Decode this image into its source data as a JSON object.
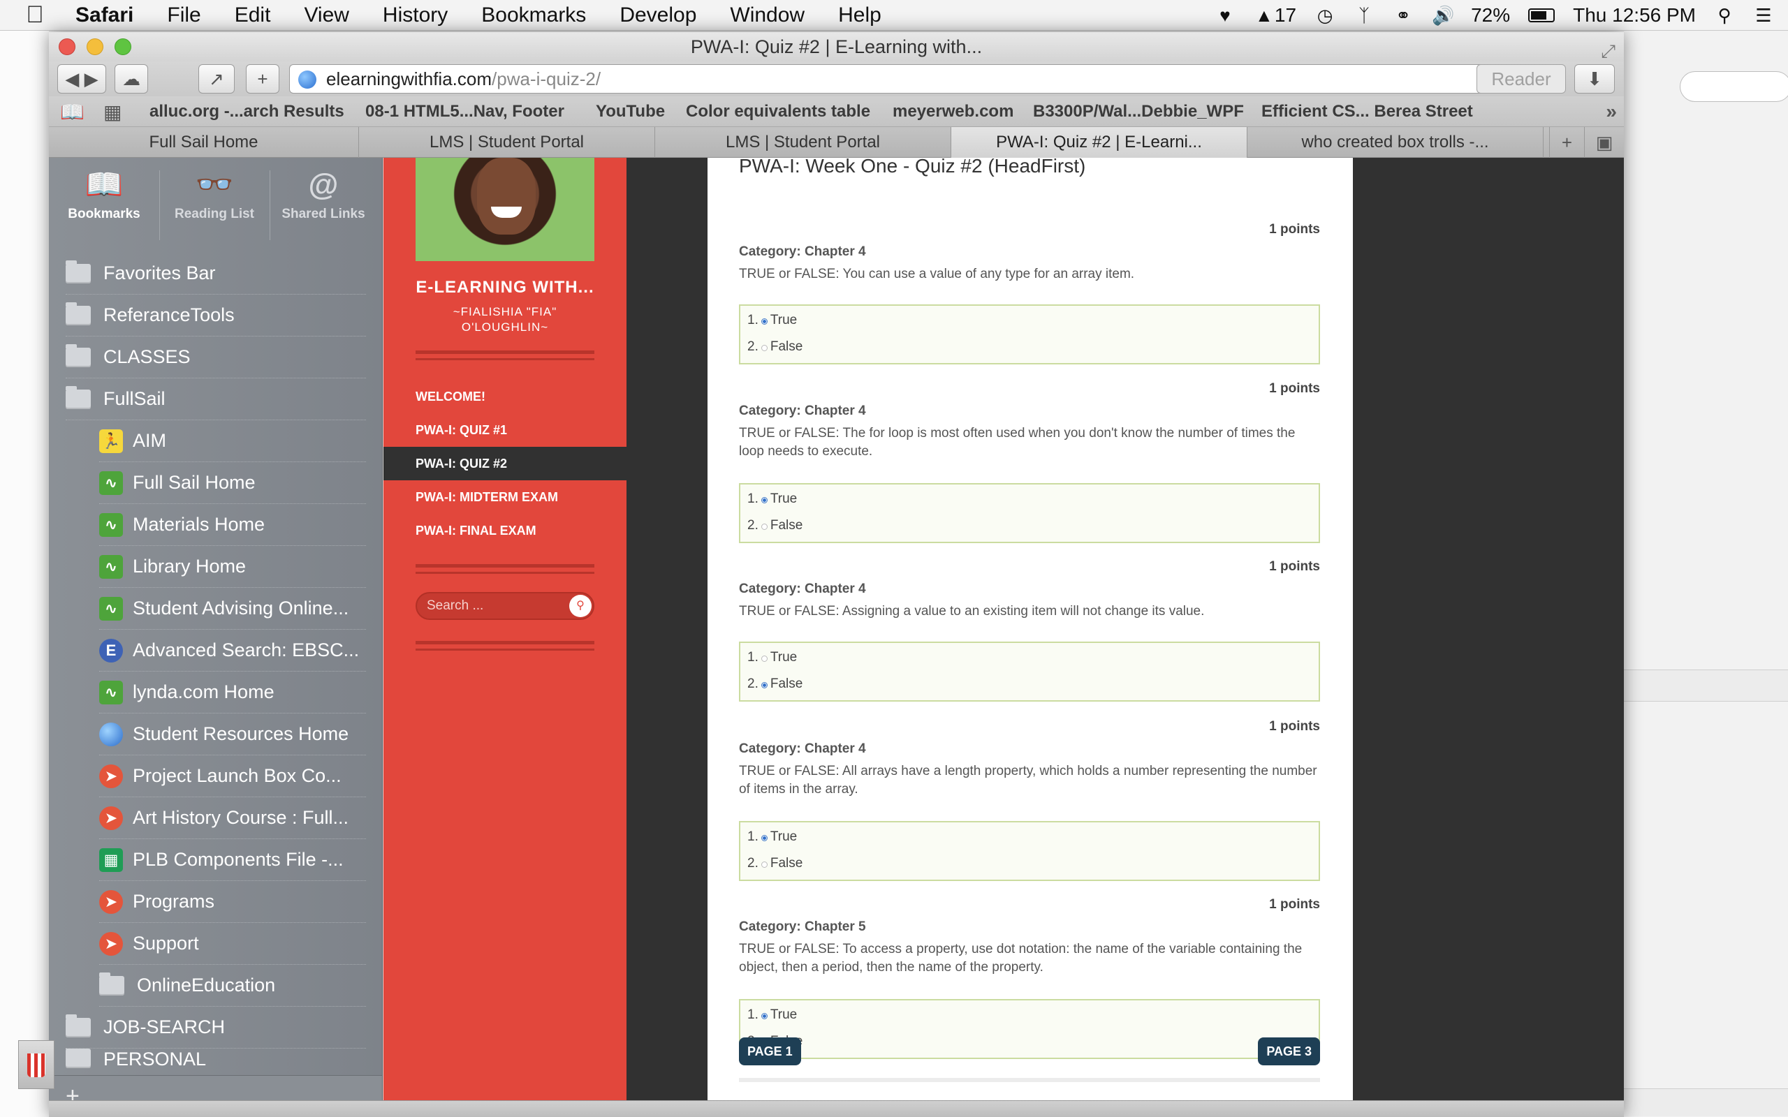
{
  "menubar": {
    "app": "Safari",
    "items": [
      "File",
      "Edit",
      "View",
      "History",
      "Bookmarks",
      "Develop",
      "Window",
      "Help"
    ],
    "status": {
      "notification_count": "17",
      "battery": "72%",
      "battery_level": 0.72,
      "clock": "Thu 12:56 PM"
    }
  },
  "window": {
    "title": "PWA-I: Quiz #2 | E-Learning with...",
    "address": {
      "domain": "elearningwithfia.com",
      "path": "/pwa-i-quiz-2/"
    },
    "reader_label": "Reader",
    "bookmarks_bar": [
      "alluc.org -...arch Results",
      "08-1 HTML5...Nav, Footer",
      "YouTube",
      "Color equivalents table",
      "meyerweb.com",
      "B3300P/Wal...Debbie_WPF",
      "Efficient CS... Berea Street"
    ],
    "tabs": [
      {
        "label": "Full Sail Home",
        "active": false
      },
      {
        "label": "LMS | Student Portal",
        "active": false
      },
      {
        "label": "LMS | Student Portal",
        "active": false
      },
      {
        "label": "PWA-I: Quiz #2 | E-Learni...",
        "active": true
      },
      {
        "label": "who created box trolls -...",
        "active": false
      }
    ]
  },
  "sidebar": {
    "tabs": [
      {
        "label": "Bookmarks",
        "icon": "book-icon"
      },
      {
        "label": "Reading List",
        "icon": "glasses-icon"
      },
      {
        "label": "Shared Links",
        "icon": "at-icon"
      }
    ],
    "items": [
      {
        "label": "Favorites Bar",
        "type": "folder",
        "indent": 0
      },
      {
        "label": "ReferanceTools",
        "type": "folder",
        "indent": 0
      },
      {
        "label": "CLASSES",
        "type": "folder",
        "indent": 0
      },
      {
        "label": "FullSail",
        "type": "folder",
        "indent": 0
      },
      {
        "label": "AIM",
        "type": "site",
        "icon": "aim-icon",
        "indent": 1
      },
      {
        "label": "Full Sail Home",
        "type": "site",
        "icon": "fullsail-icon",
        "indent": 1
      },
      {
        "label": "Materials Home",
        "type": "site",
        "icon": "fullsail-icon",
        "indent": 1
      },
      {
        "label": "Library Home",
        "type": "site",
        "icon": "fullsail-icon",
        "indent": 1
      },
      {
        "label": "Student Advising Online...",
        "type": "site",
        "icon": "fullsail-icon",
        "indent": 1
      },
      {
        "label": "Advanced Search: EBSC...",
        "type": "site",
        "icon": "ebsco-icon",
        "indent": 1
      },
      {
        "label": "lynda.com Home",
        "type": "site",
        "icon": "fullsail-icon",
        "indent": 1
      },
      {
        "label": "Student Resources Home",
        "type": "site",
        "icon": "globe-icon",
        "indent": 1
      },
      {
        "label": "Project Launch Box Co...",
        "type": "site",
        "icon": "launchbox-icon",
        "indent": 1
      },
      {
        "label": "Art History Course : Full...",
        "type": "site",
        "icon": "launchbox-icon",
        "indent": 1
      },
      {
        "label": "PLB Components File -...",
        "type": "site",
        "icon": "spreadsheet-icon",
        "indent": 1
      },
      {
        "label": "Programs",
        "type": "site",
        "icon": "launchbox-icon",
        "indent": 1
      },
      {
        "label": "Support",
        "type": "site",
        "icon": "launchbox-icon",
        "indent": 1
      },
      {
        "label": "OnlineEducation",
        "type": "folder",
        "indent": 1
      },
      {
        "label": "JOB-SEARCH",
        "type": "folder",
        "indent": 0
      },
      {
        "label": "PERSONAL",
        "type": "folder",
        "indent": 0
      }
    ]
  },
  "site": {
    "title": "E-LEARNING WITH...",
    "subtitle": "~FIALISHIA \"FIA\" O'LOUGHLIN~",
    "nav": [
      {
        "label": "WELCOME!",
        "active": false
      },
      {
        "label": "PWA-I: QUIZ #1",
        "active": false
      },
      {
        "label": "PWA-I: QUIZ #2",
        "active": true
      },
      {
        "label": "PWA-I: MIDTERM EXAM",
        "active": false
      },
      {
        "label": "PWA-I: FINAL EXAM",
        "active": false
      }
    ],
    "search_placeholder": "Search ..."
  },
  "quiz": {
    "title": "PWA-I: Week One - Quiz #2 (HeadFirst)",
    "questions": [
      {
        "points": "1 points",
        "category": "Category: Chapter 4",
        "text": "TRUE or FALSE:  You can use a value of any type for an array item.",
        "answers": [
          "1.",
          "2."
        ],
        "answer_labels": [
          "True",
          "False"
        ],
        "selected": 0
      },
      {
        "points": "1 points",
        "category": "Category: Chapter 4",
        "text": "TRUE or FALSE:  The for loop is most often used when you don't know the number of times the loop needs to execute.",
        "answers": [
          "1.",
          "2."
        ],
        "answer_labels": [
          "True",
          "False"
        ],
        "selected": 0
      },
      {
        "points": "1 points",
        "category": "Category: Chapter 4",
        "text": "TRUE or FALSE:  Assigning a value to an existing item will not change its value.",
        "answers": [
          "1.",
          "2."
        ],
        "answer_labels": [
          "True",
          "False"
        ],
        "selected": 1
      },
      {
        "points": "1 points",
        "category": "Category: Chapter 4",
        "text": "TRUE or FALSE:  All arrays have a length property, which holds a number representing the number of items in the array.",
        "answers": [
          "1.",
          "2."
        ],
        "answer_labels": [
          "True",
          "False"
        ],
        "selected": 0
      },
      {
        "points": "1 points",
        "category": "Category: Chapter 5",
        "text": "TRUE or FALSE:  To access a property, use dot notation: the name of the variable containing the object, then a period, then the name of the property.",
        "answers": [
          "1.",
          "2."
        ],
        "answer_labels": [
          "True",
          "False"
        ],
        "selected": 0
      }
    ],
    "prev_label": "PAGE 1",
    "next_label": "PAGE 3"
  },
  "colors": {
    "site_red": "#e2473c",
    "page_button": "#1e3f55",
    "answer_border": "#cbdca0"
  }
}
